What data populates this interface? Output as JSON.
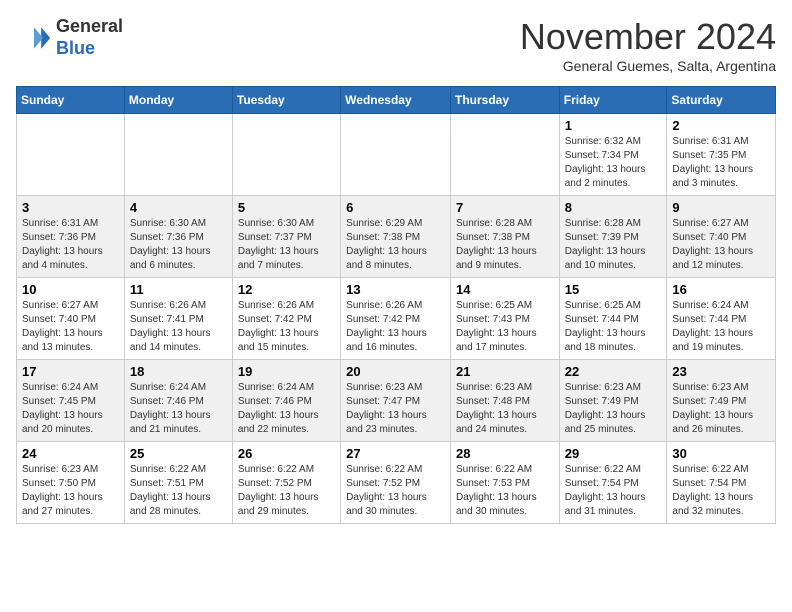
{
  "header": {
    "logo_line1": "General",
    "logo_line2": "Blue",
    "month": "November 2024",
    "location": "General Guemes, Salta, Argentina"
  },
  "weekdays": [
    "Sunday",
    "Monday",
    "Tuesday",
    "Wednesday",
    "Thursday",
    "Friday",
    "Saturday"
  ],
  "weeks": [
    [
      {
        "day": "",
        "info": ""
      },
      {
        "day": "",
        "info": ""
      },
      {
        "day": "",
        "info": ""
      },
      {
        "day": "",
        "info": ""
      },
      {
        "day": "",
        "info": ""
      },
      {
        "day": "1",
        "info": "Sunrise: 6:32 AM\nSunset: 7:34 PM\nDaylight: 13 hours and 2 minutes."
      },
      {
        "day": "2",
        "info": "Sunrise: 6:31 AM\nSunset: 7:35 PM\nDaylight: 13 hours and 3 minutes."
      }
    ],
    [
      {
        "day": "3",
        "info": "Sunrise: 6:31 AM\nSunset: 7:36 PM\nDaylight: 13 hours and 4 minutes."
      },
      {
        "day": "4",
        "info": "Sunrise: 6:30 AM\nSunset: 7:36 PM\nDaylight: 13 hours and 6 minutes."
      },
      {
        "day": "5",
        "info": "Sunrise: 6:30 AM\nSunset: 7:37 PM\nDaylight: 13 hours and 7 minutes."
      },
      {
        "day": "6",
        "info": "Sunrise: 6:29 AM\nSunset: 7:38 PM\nDaylight: 13 hours and 8 minutes."
      },
      {
        "day": "7",
        "info": "Sunrise: 6:28 AM\nSunset: 7:38 PM\nDaylight: 13 hours and 9 minutes."
      },
      {
        "day": "8",
        "info": "Sunrise: 6:28 AM\nSunset: 7:39 PM\nDaylight: 13 hours and 10 minutes."
      },
      {
        "day": "9",
        "info": "Sunrise: 6:27 AM\nSunset: 7:40 PM\nDaylight: 13 hours and 12 minutes."
      }
    ],
    [
      {
        "day": "10",
        "info": "Sunrise: 6:27 AM\nSunset: 7:40 PM\nDaylight: 13 hours and 13 minutes."
      },
      {
        "day": "11",
        "info": "Sunrise: 6:26 AM\nSunset: 7:41 PM\nDaylight: 13 hours and 14 minutes."
      },
      {
        "day": "12",
        "info": "Sunrise: 6:26 AM\nSunset: 7:42 PM\nDaylight: 13 hours and 15 minutes."
      },
      {
        "day": "13",
        "info": "Sunrise: 6:26 AM\nSunset: 7:42 PM\nDaylight: 13 hours and 16 minutes."
      },
      {
        "day": "14",
        "info": "Sunrise: 6:25 AM\nSunset: 7:43 PM\nDaylight: 13 hours and 17 minutes."
      },
      {
        "day": "15",
        "info": "Sunrise: 6:25 AM\nSunset: 7:44 PM\nDaylight: 13 hours and 18 minutes."
      },
      {
        "day": "16",
        "info": "Sunrise: 6:24 AM\nSunset: 7:44 PM\nDaylight: 13 hours and 19 minutes."
      }
    ],
    [
      {
        "day": "17",
        "info": "Sunrise: 6:24 AM\nSunset: 7:45 PM\nDaylight: 13 hours and 20 minutes."
      },
      {
        "day": "18",
        "info": "Sunrise: 6:24 AM\nSunset: 7:46 PM\nDaylight: 13 hours and 21 minutes."
      },
      {
        "day": "19",
        "info": "Sunrise: 6:24 AM\nSunset: 7:46 PM\nDaylight: 13 hours and 22 minutes."
      },
      {
        "day": "20",
        "info": "Sunrise: 6:23 AM\nSunset: 7:47 PM\nDaylight: 13 hours and 23 minutes."
      },
      {
        "day": "21",
        "info": "Sunrise: 6:23 AM\nSunset: 7:48 PM\nDaylight: 13 hours and 24 minutes."
      },
      {
        "day": "22",
        "info": "Sunrise: 6:23 AM\nSunset: 7:49 PM\nDaylight: 13 hours and 25 minutes."
      },
      {
        "day": "23",
        "info": "Sunrise: 6:23 AM\nSunset: 7:49 PM\nDaylight: 13 hours and 26 minutes."
      }
    ],
    [
      {
        "day": "24",
        "info": "Sunrise: 6:23 AM\nSunset: 7:50 PM\nDaylight: 13 hours and 27 minutes."
      },
      {
        "day": "25",
        "info": "Sunrise: 6:22 AM\nSunset: 7:51 PM\nDaylight: 13 hours and 28 minutes."
      },
      {
        "day": "26",
        "info": "Sunrise: 6:22 AM\nSunset: 7:52 PM\nDaylight: 13 hours and 29 minutes."
      },
      {
        "day": "27",
        "info": "Sunrise: 6:22 AM\nSunset: 7:52 PM\nDaylight: 13 hours and 30 minutes."
      },
      {
        "day": "28",
        "info": "Sunrise: 6:22 AM\nSunset: 7:53 PM\nDaylight: 13 hours and 30 minutes."
      },
      {
        "day": "29",
        "info": "Sunrise: 6:22 AM\nSunset: 7:54 PM\nDaylight: 13 hours and 31 minutes."
      },
      {
        "day": "30",
        "info": "Sunrise: 6:22 AM\nSunset: 7:54 PM\nDaylight: 13 hours and 32 minutes."
      }
    ]
  ]
}
